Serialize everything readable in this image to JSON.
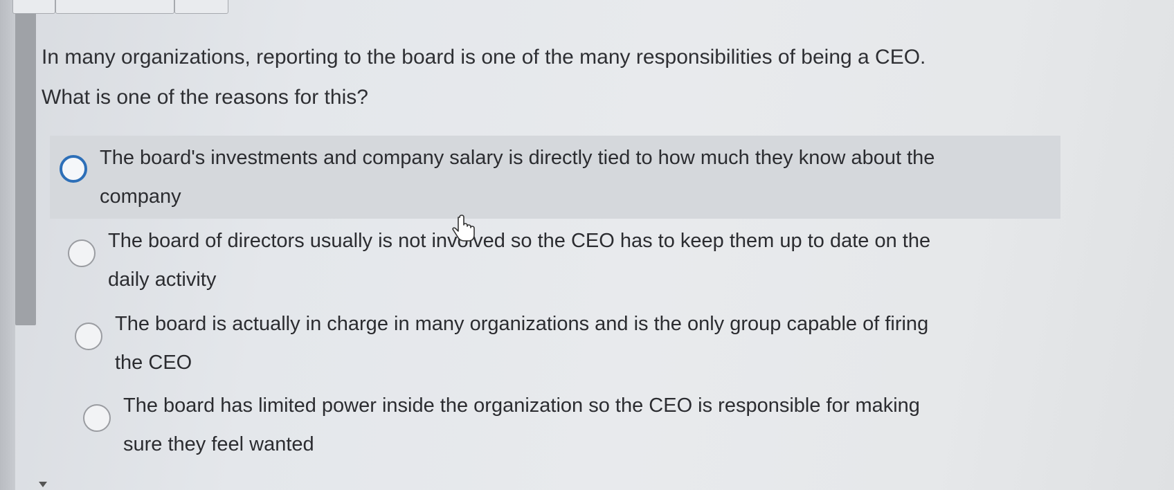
{
  "question": {
    "line1": "In many organizations, reporting to the board is one of the many responsibilities of being a CEO.",
    "line2": "What is one of the reasons for this?"
  },
  "options": [
    {
      "line1": "The board's investments and company salary is directly tied to how much they know about the",
      "line2": "company",
      "selected": false,
      "hovered": true
    },
    {
      "line1": "The board of directors usually is not involved so the CEO has to keep them up to date on the",
      "line2": "daily activity",
      "selected": false,
      "hovered": false
    },
    {
      "line1": "The board is actually in charge in many organizations and is the only group capable of firing",
      "line2": "the CEO",
      "selected": false,
      "hovered": false
    },
    {
      "line1": "The board has limited power inside the organization so the CEO is responsible for making",
      "line2": "sure they feel wanted",
      "selected": false,
      "hovered": false
    }
  ],
  "colors": {
    "focus_ring": "#2d6fb8",
    "hover_background": "#d5d8dc",
    "text": "#2b2c30"
  },
  "icons": {
    "cursor": "hand-pointer-icon",
    "radio": "radio-button-icon"
  }
}
